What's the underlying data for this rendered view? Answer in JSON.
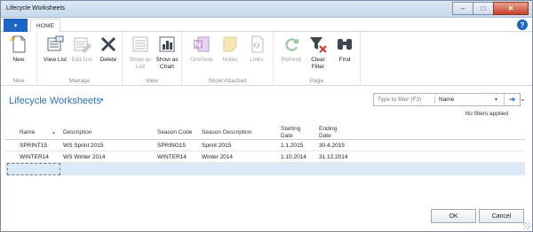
{
  "window": {
    "title": "Lifecycle Worksheets"
  },
  "window_buttons": {
    "minimize": "–",
    "maximize": "□",
    "close": "✕"
  },
  "tabs": {
    "app_menu": "▾",
    "home": "HOME",
    "help": "?"
  },
  "ribbon": {
    "groups": [
      {
        "label": "New",
        "buttons": [
          {
            "label": "New",
            "disabled": false,
            "icon": "new-document-icon"
          }
        ]
      },
      {
        "label": "Manage",
        "buttons": [
          {
            "label": "View List",
            "disabled": false,
            "icon": "view-list-icon"
          },
          {
            "label": "Edit List",
            "disabled": true,
            "icon": "edit-list-icon"
          },
          {
            "label": "Delete",
            "disabled": false,
            "icon": "delete-x-icon"
          }
        ]
      },
      {
        "label": "View",
        "buttons": [
          {
            "label": "Show as List",
            "disabled": true,
            "icon": "show-as-list-icon"
          },
          {
            "label": "Show as Chart",
            "disabled": false,
            "icon": "show-as-chart-icon"
          }
        ]
      },
      {
        "label": "Show Attached",
        "buttons": [
          {
            "label": "OneNote",
            "disabled": true,
            "icon": "onenote-icon"
          },
          {
            "label": "Notes",
            "disabled": true,
            "icon": "notes-icon"
          },
          {
            "label": "Links",
            "disabled": true,
            "icon": "links-icon"
          }
        ]
      },
      {
        "label": "Page",
        "buttons": [
          {
            "label": "Refresh",
            "disabled": true,
            "icon": "refresh-icon"
          },
          {
            "label": "Clear Filter",
            "disabled": false,
            "icon": "clear-filter-icon"
          },
          {
            "label": "Find",
            "disabled": false,
            "icon": "find-binoculars-icon"
          }
        ]
      }
    ]
  },
  "page": {
    "title": "Lifecycle Worksheets",
    "title_menu": "▾"
  },
  "filter": {
    "placeholder": "Type to filter (F3)",
    "field": "Name",
    "field_menu": "▾",
    "go": "➔",
    "collapse": "⌄",
    "status": "No filters applied"
  },
  "table": {
    "sort_indicator": "▲",
    "columns": [
      "Name",
      "Description",
      "Season Code",
      "Season Description",
      "Starting Date",
      "Ending Date"
    ],
    "rows": [
      [
        "SPRINT15",
        "WS Sprint 2015",
        "SPRING15",
        "Sprint 2015",
        "1.1.2015",
        "30.4.2015"
      ],
      [
        "WINTER14",
        "WS Winter 2014",
        "WINTER14",
        "Winter 2014",
        "1.10.2014",
        "31.12.2014"
      ]
    ]
  },
  "footer": {
    "ok": "OK",
    "cancel": "Cancel"
  },
  "colors": {
    "accent": "#1b65c4",
    "title_text": "#2c6fbe",
    "selected_row": "#dbe8f5"
  }
}
